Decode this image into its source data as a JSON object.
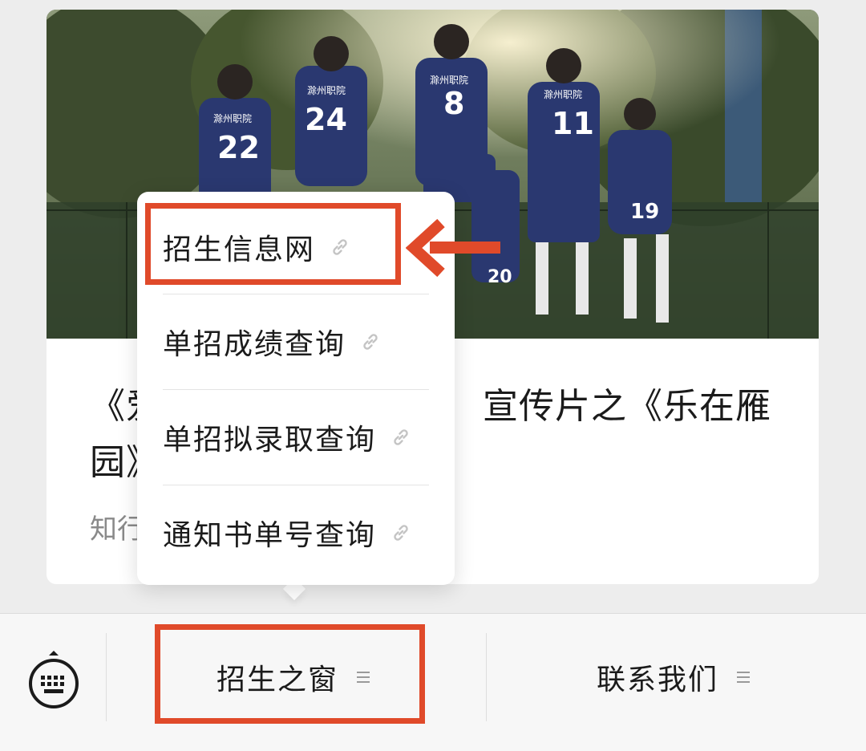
{
  "article": {
    "title_line1": "《爱",
    "title_line1_right": "宣传片之《乐在雁",
    "title_line2": "园》",
    "source": "知行"
  },
  "hero_image": {
    "jersey_numbers": [
      "22",
      "24",
      "8",
      "11",
      "19",
      "20"
    ],
    "jersey_text": "滁州职院"
  },
  "popup_menu": {
    "items": [
      {
        "label": "招生信息网",
        "icon": "link-icon"
      },
      {
        "label": "单招成绩查询",
        "icon": "link-icon"
      },
      {
        "label": "单招拟录取查询",
        "icon": "link-icon"
      },
      {
        "label": "通知书单号查询",
        "icon": "link-icon"
      }
    ]
  },
  "bottom_bar": {
    "keyboard_icon": "keyboard-icon",
    "menus": [
      {
        "label": "招生之窗",
        "icon": "menu-lines-icon"
      },
      {
        "label": "联系我们",
        "icon": "menu-lines-icon"
      }
    ]
  },
  "colors": {
    "highlight": "#e04a2a",
    "background": "#ededed",
    "jersey": "#2a3870"
  }
}
